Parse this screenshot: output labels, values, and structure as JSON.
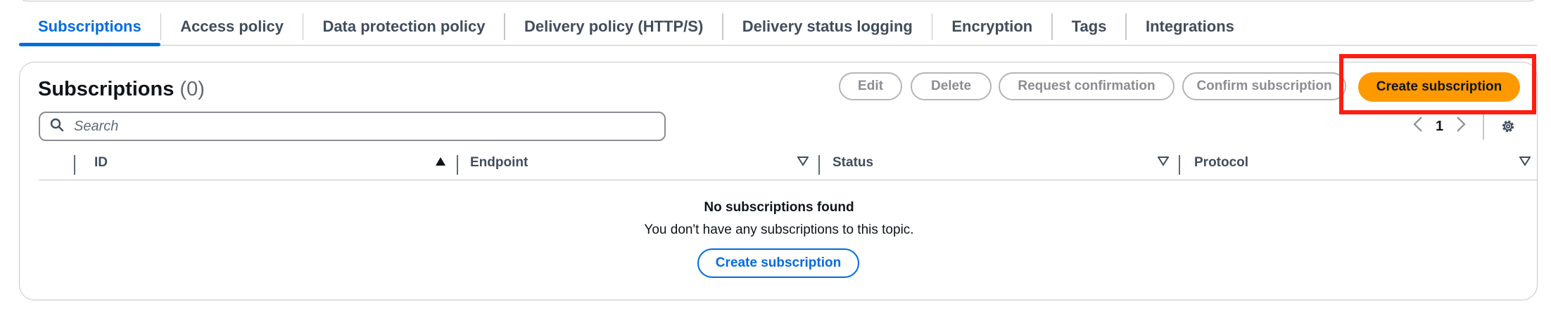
{
  "tabs": [
    {
      "label": "Subscriptions",
      "active": true
    },
    {
      "label": "Access policy"
    },
    {
      "label": "Data protection policy"
    },
    {
      "label": "Delivery policy (HTTP/S)"
    },
    {
      "label": "Delivery status logging"
    },
    {
      "label": "Encryption"
    },
    {
      "label": "Tags"
    },
    {
      "label": "Integrations"
    }
  ],
  "panel": {
    "title": "Subscriptions",
    "count": "(0)",
    "buttons": {
      "edit": "Edit",
      "delete": "Delete",
      "request_confirmation": "Request confirmation",
      "confirm_subscription": "Confirm subscription",
      "create_subscription": "Create subscription"
    },
    "search": {
      "placeholder": "Search",
      "value": ""
    },
    "pagination": {
      "current_page": "1"
    },
    "columns": [
      {
        "label": "ID",
        "sort": "ascending"
      },
      {
        "label": "Endpoint",
        "sort": "none"
      },
      {
        "label": "Status",
        "sort": "none"
      },
      {
        "label": "Protocol",
        "sort": "none"
      }
    ],
    "empty_state": {
      "title": "No subscriptions found",
      "description": "You don't have any subscriptions to this topic.",
      "button": "Create subscription"
    }
  },
  "colors": {
    "accent": "#006ce0",
    "primary_button": "#ff9900",
    "highlight": "#ff1d12",
    "border": "#c6c6cd"
  },
  "icons": [
    "search-icon",
    "sort-ascending-icon",
    "sort-descending-outline-icon",
    "chevron-left-icon",
    "chevron-right-icon",
    "gear-icon"
  ]
}
